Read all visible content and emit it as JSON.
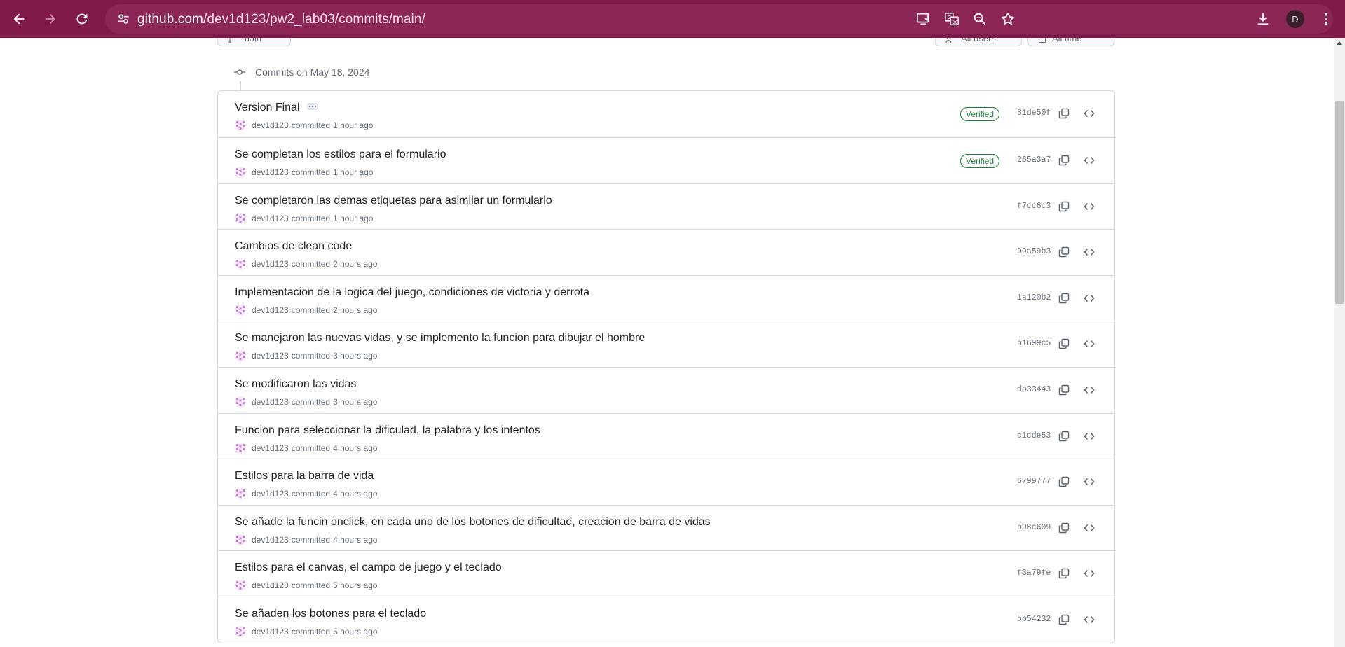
{
  "browser": {
    "url_host": "github.com",
    "url_path": "/dev1d123/pw2_lab03/commits/main/",
    "profile_initial": "D"
  },
  "filters": {
    "branch_label": "main",
    "users_label": "All users",
    "time_label": "All time"
  },
  "group": {
    "title": "Commits on May 18, 2024"
  },
  "commits": [
    {
      "message": "Version Final",
      "has_ellipsis": true,
      "author": "dev1d123",
      "action": "committed",
      "time": "1 hour ago",
      "verified": "Verified",
      "sha": "81de50f"
    },
    {
      "message": "Se completan los estilos para el formulario",
      "has_ellipsis": false,
      "author": "dev1d123",
      "action": "committed",
      "time": "1 hour ago",
      "verified": "Verified",
      "sha": "265a3a7"
    },
    {
      "message": "Se completaron las demas etiquetas para asimilar un formulario",
      "has_ellipsis": false,
      "author": "dev1d123",
      "action": "committed",
      "time": "1 hour ago",
      "verified": "",
      "sha": "f7cc6c3"
    },
    {
      "message": "Cambios de clean code",
      "has_ellipsis": false,
      "author": "dev1d123",
      "action": "committed",
      "time": "2 hours ago",
      "verified": "",
      "sha": "99a59b3"
    },
    {
      "message": "Implementacion de la logica del juego, condiciones de victoria y derrota",
      "has_ellipsis": false,
      "author": "dev1d123",
      "action": "committed",
      "time": "2 hours ago",
      "verified": "",
      "sha": "1a120b2"
    },
    {
      "message": "Se manejaron las nuevas vidas, y se implemento la funcion para dibujar el hombre",
      "has_ellipsis": false,
      "author": "dev1d123",
      "action": "committed",
      "time": "3 hours ago",
      "verified": "",
      "sha": "b1699c5"
    },
    {
      "message": "Se modificaron las vidas",
      "has_ellipsis": false,
      "author": "dev1d123",
      "action": "committed",
      "time": "3 hours ago",
      "verified": "",
      "sha": "db33443"
    },
    {
      "message": "Funcion para seleccionar la dificulad, la palabra y los intentos",
      "has_ellipsis": false,
      "author": "dev1d123",
      "action": "committed",
      "time": "4 hours ago",
      "verified": "",
      "sha": "c1cde53"
    },
    {
      "message": "Estilos para la barra de vida",
      "has_ellipsis": false,
      "author": "dev1d123",
      "action": "committed",
      "time": "4 hours ago",
      "verified": "",
      "sha": "6799777"
    },
    {
      "message": "Se añade la funcin onclick, en cada uno de los botones de dificultad, creacion de barra de vidas",
      "has_ellipsis": false,
      "author": "dev1d123",
      "action": "committed",
      "time": "4 hours ago",
      "verified": "",
      "sha": "b98c609"
    },
    {
      "message": "Estilos para el canvas, el campo de juego y el teclado",
      "has_ellipsis": false,
      "author": "dev1d123",
      "action": "committed",
      "time": "5 hours ago",
      "verified": "",
      "sha": "f3a79fe"
    },
    {
      "message": "Se añaden los botones para el teclado",
      "has_ellipsis": false,
      "author": "dev1d123",
      "action": "committed",
      "time": "5 hours ago",
      "verified": "",
      "sha": "bb54232"
    }
  ],
  "colors": {
    "chrome": "#7f1a4b",
    "omnibox": "#8c2657",
    "verified_green": "#1a7f37",
    "avatar_purple": "#c678dd"
  }
}
